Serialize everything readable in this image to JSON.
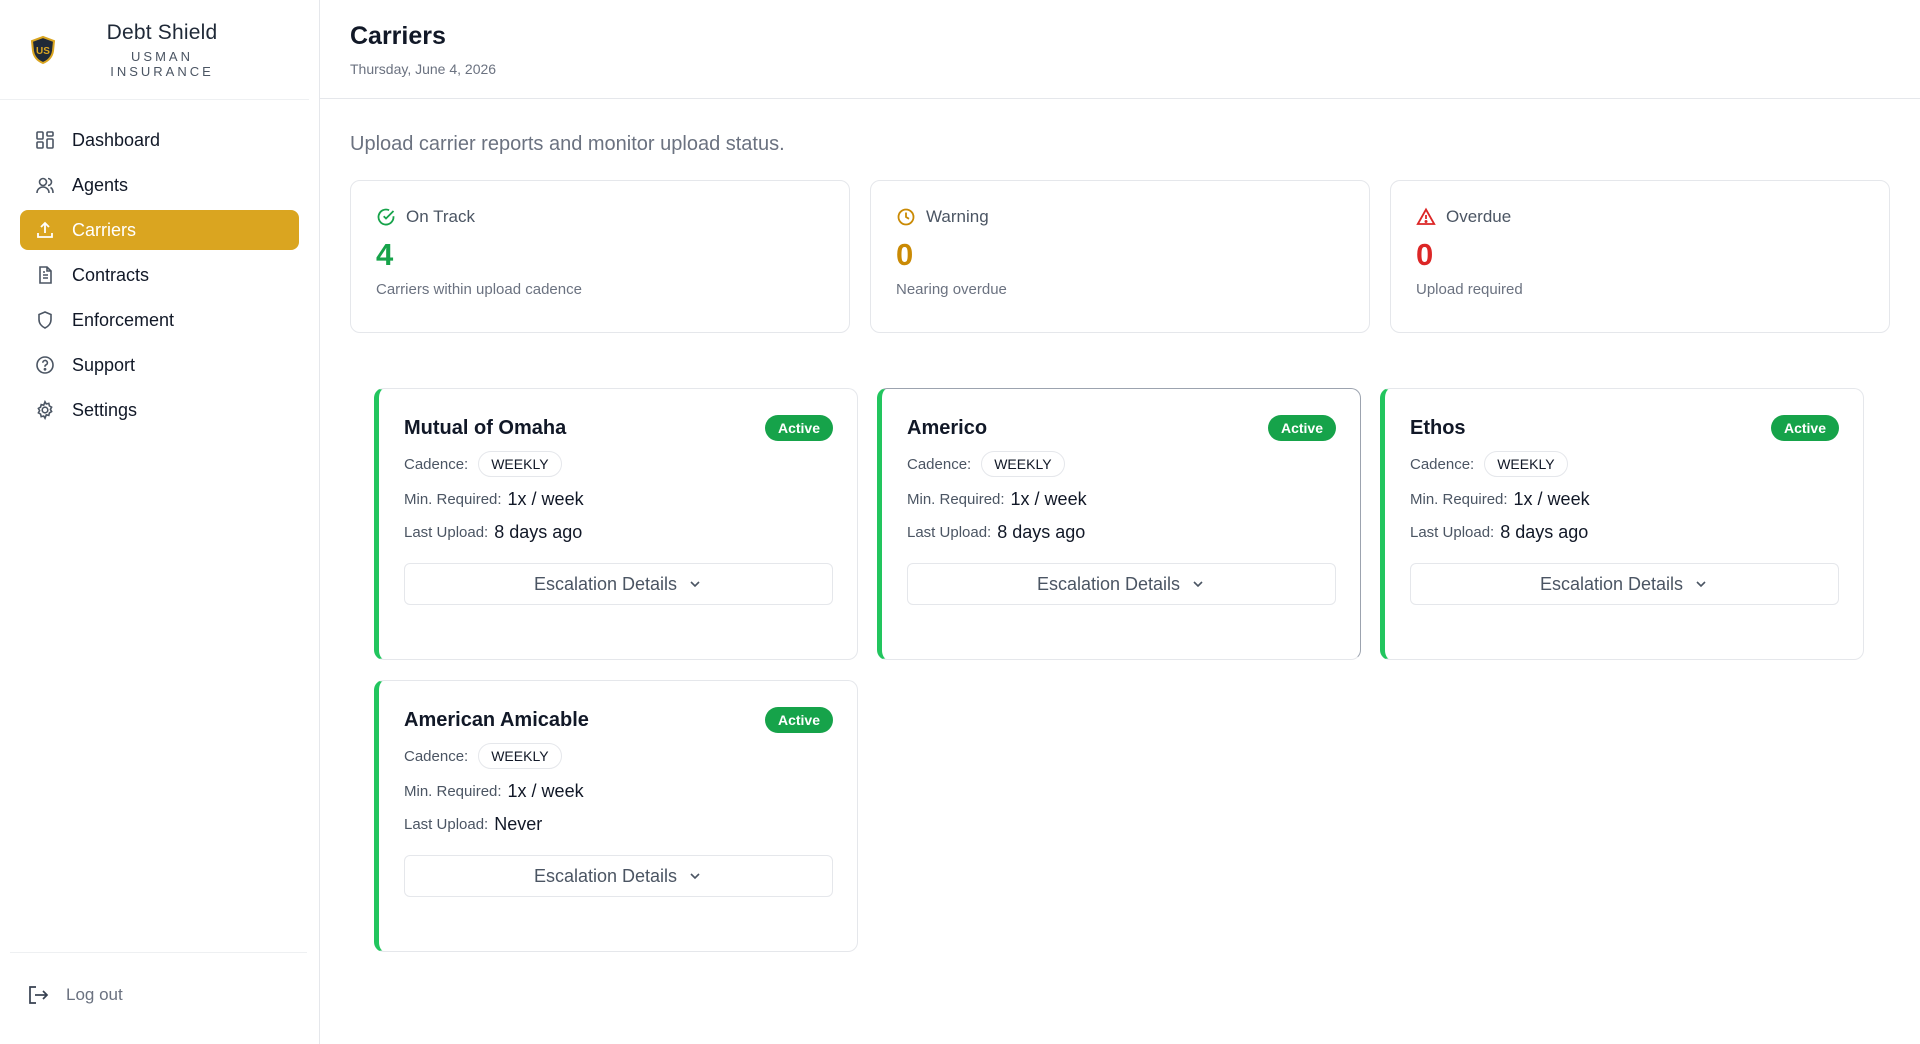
{
  "brand": {
    "name": "Debt Shield",
    "sub": "USMAN INSURANCE"
  },
  "nav": [
    {
      "label": "Dashboard",
      "icon": "grid-icon"
    },
    {
      "label": "Agents",
      "icon": "users-icon"
    },
    {
      "label": "Carriers",
      "icon": "upload-icon",
      "active": true
    },
    {
      "label": "Contracts",
      "icon": "file-icon"
    },
    {
      "label": "Enforcement",
      "icon": "shield-icon"
    },
    {
      "label": "Support",
      "icon": "help-circle-icon"
    },
    {
      "label": "Settings",
      "icon": "gear-icon"
    }
  ],
  "logout": "Log out",
  "header": {
    "title": "Carriers",
    "date": "Thursday, June 4, 2026"
  },
  "subtitle": "Upload carrier reports and monitor upload status.",
  "stats": [
    {
      "label": "On Track",
      "value": "4",
      "desc": "Carriers within upload cadence",
      "color": "#16a34a"
    },
    {
      "label": "Warning",
      "value": "0",
      "desc": "Nearing overdue",
      "color": "#ca8a04"
    },
    {
      "label": "Overdue",
      "value": "0",
      "desc": "Upload required",
      "color": "#dc2626"
    }
  ],
  "labels": {
    "cadence": "Cadence:",
    "min_required": "Min. Required:",
    "last_upload": "Last Upload:",
    "escalation": "Escalation Details"
  },
  "carriers": [
    {
      "name": "Mutual of Omaha",
      "status": "Active",
      "cadence": "WEEKLY",
      "min_required": "1x / week",
      "last_upload": "8 days ago"
    },
    {
      "name": "Americo",
      "status": "Active",
      "cadence": "WEEKLY",
      "min_required": "1x / week",
      "last_upload": "8 days ago"
    },
    {
      "name": "Ethos",
      "status": "Active",
      "cadence": "WEEKLY",
      "min_required": "1x / week",
      "last_upload": "8 days ago"
    },
    {
      "name": "American Amicable",
      "status": "Active",
      "cadence": "WEEKLY",
      "min_required": "1x / week",
      "last_upload": "Never"
    }
  ],
  "colors": {
    "accent": "#daa520",
    "success": "#16a34a",
    "card_border": "#22c55e"
  }
}
